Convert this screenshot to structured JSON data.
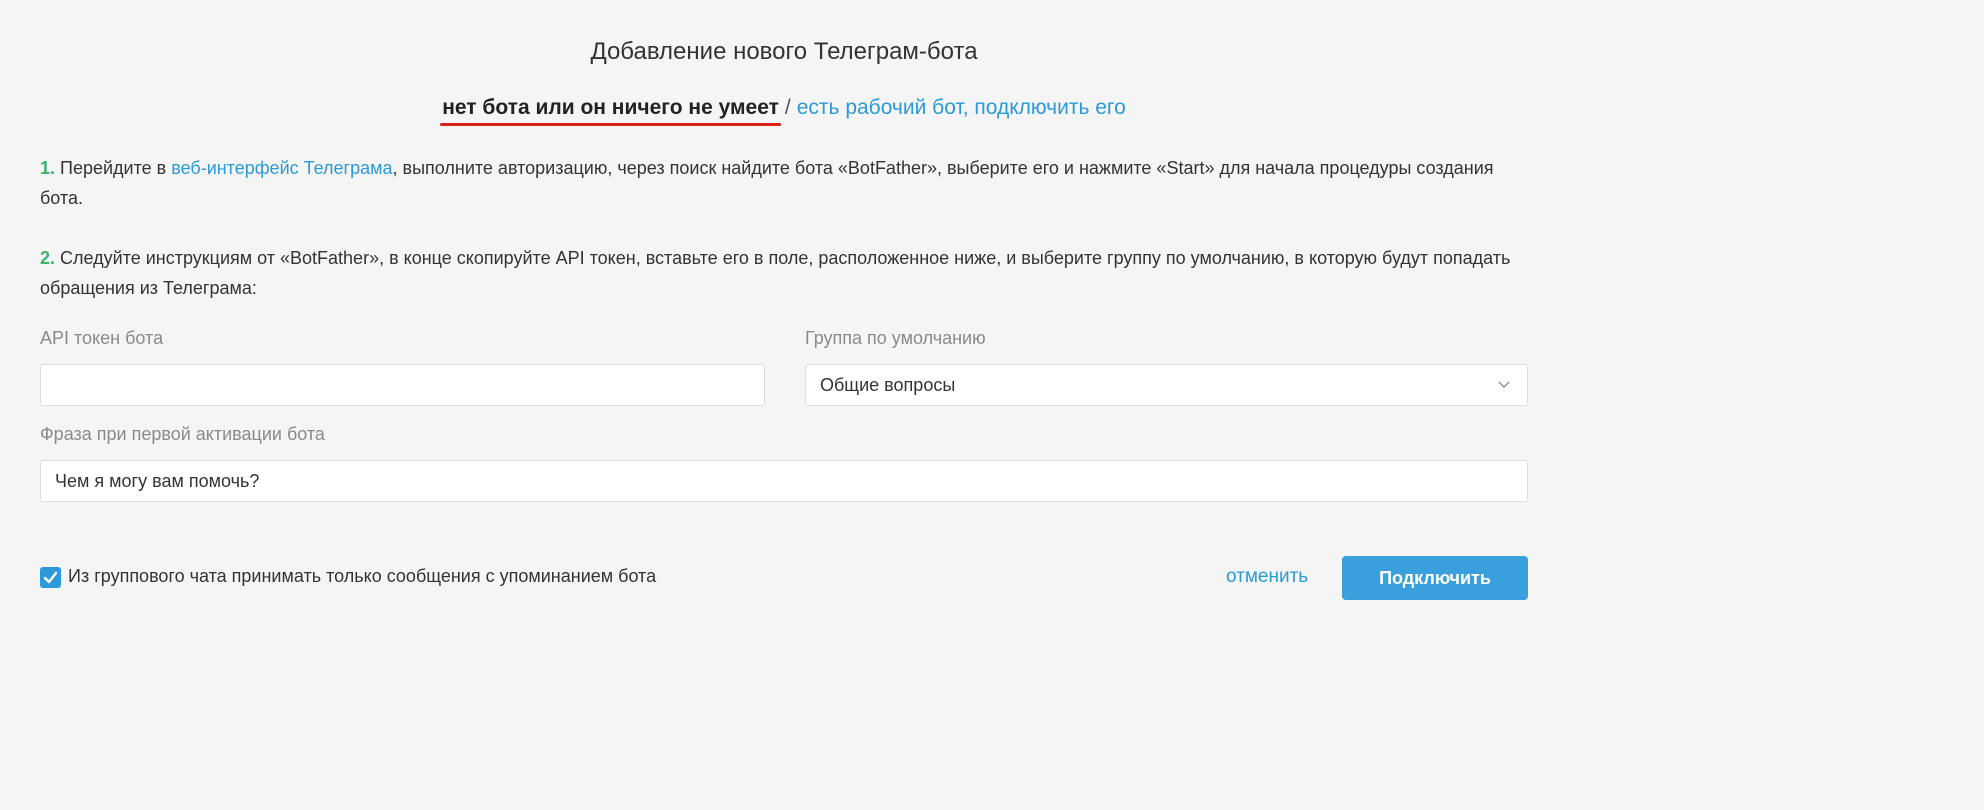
{
  "dialog": {
    "title": "Добавление нового Телеграм-бота"
  },
  "mode_switch": {
    "active": "нет бота или он ничего не умеет",
    "separator": "/",
    "alternative": "есть рабочий бот, подключить его"
  },
  "steps": [
    {
      "number": "1.",
      "text_before": " Перейдите в ",
      "link": "веб-интерфейс Телеграма",
      "text_after": ", выполните авторизацию, через поиск найдите бота «BotFather», выберите его и нажмите «Start» для начала процедуры создания бота."
    },
    {
      "number": "2.",
      "text": " Следуйте инструкциям от «BotFather», в конце скопируйте API токен, вставьте его в поле, расположенное ниже, и выберите группу по умолчанию, в которую будут попадать обращения из Телеграма:"
    }
  ],
  "form": {
    "token_label": "API токен бота",
    "token_value": "",
    "group_label": "Группа по умолчанию",
    "group_value": "Общие вопросы",
    "phrase_label": "Фраза при первой активации бота",
    "phrase_value": "Чем я могу вам помочь?"
  },
  "footer": {
    "checkbox_label": "Из группового чата принимать только сообщения с упоминанием бота",
    "checkbox_checked": true,
    "cancel_label": "отменить",
    "connect_label": "Подключить"
  },
  "colors": {
    "accent": "#2b9ad6",
    "step_number": "#3bb36b",
    "underline": "#d9201a",
    "button": "#3a9fdd",
    "background": "#f5f5f5"
  }
}
